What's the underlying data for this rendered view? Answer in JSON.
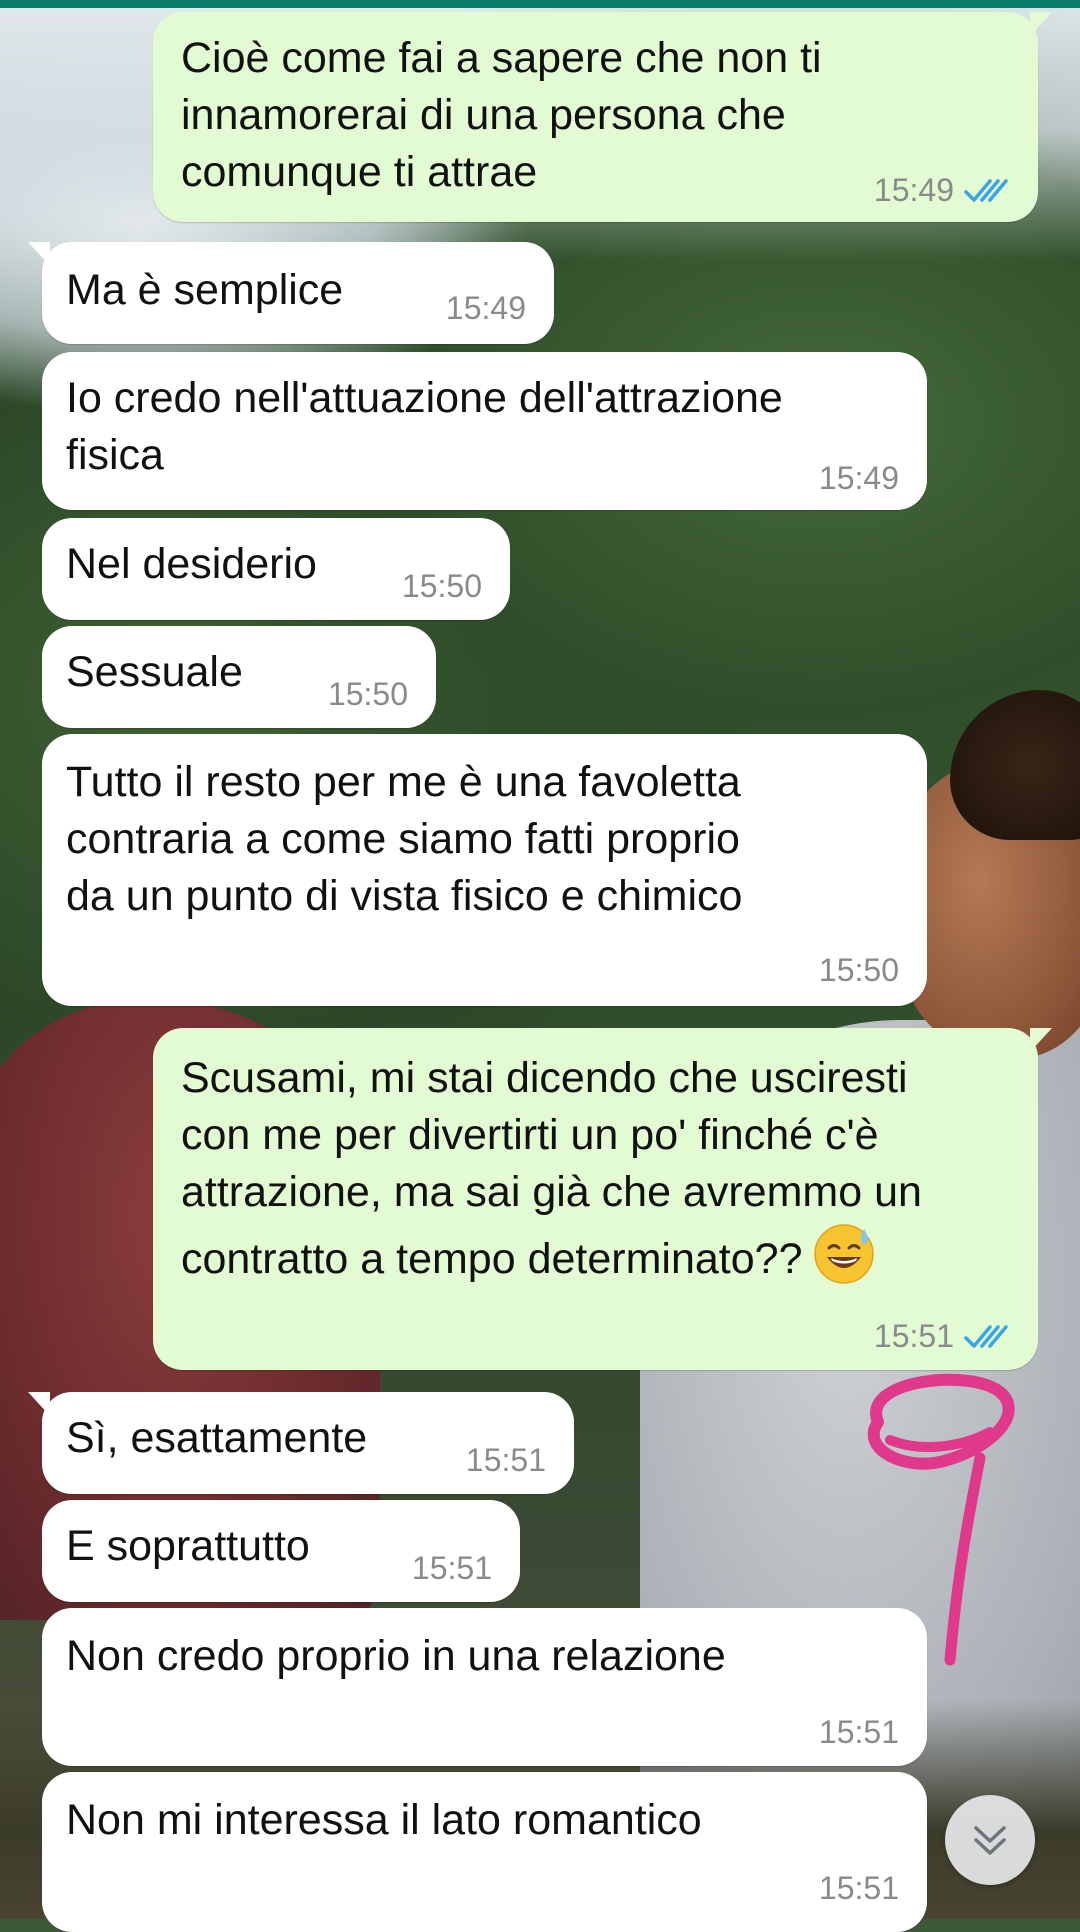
{
  "messages": [
    {
      "direction": "outgoing",
      "text": "Cioè come fai a sapere che non ti\ninnamorerai di una persona che\ncomunque ti attrae",
      "time": "15:49",
      "status_icon": "double-check-icon"
    },
    {
      "direction": "incoming",
      "text": "Ma è semplice",
      "time": "15:49"
    },
    {
      "direction": "incoming",
      "text": "Io credo nell'attuazione dell'attrazione\nfisica",
      "time": "15:49"
    },
    {
      "direction": "incoming",
      "text": "Nel desiderio",
      "time": "15:50"
    },
    {
      "direction": "incoming",
      "text": "Sessuale",
      "time": "15:50"
    },
    {
      "direction": "incoming",
      "text": "Tutto il resto per me è una favoletta\ncontraria a come siamo fatti proprio\nda un punto di vista fisico e chimico",
      "time": "15:50"
    },
    {
      "direction": "outgoing",
      "text": "Scusami, mi stai dicendo che usciresti\ncon me per divertirti un po' finché c'è\nattrazione, ma sai già che avremmo un\ncontratto a tempo determinato??",
      "emoji": "sweat-smile-emoji-icon",
      "time": "15:51",
      "status_icon": "double-check-icon"
    },
    {
      "direction": "incoming",
      "text": "Sì, esattamente",
      "time": "15:51"
    },
    {
      "direction": "incoming",
      "text": "E soprattutto",
      "time": "15:51"
    },
    {
      "direction": "incoming",
      "text": "Non credo proprio in una relazione",
      "time": "15:51"
    },
    {
      "direction": "incoming",
      "text": "Non mi interessa il lato romantico",
      "time": "15:51"
    }
  ],
  "colors": {
    "incoming_bubble": "#ffffff",
    "outgoing_bubble": "#e3fbd3",
    "timestamp": "#8a8a8a",
    "read_ticks": "#3aa4e6",
    "top_bar": "#0a7a6a",
    "annotation_marker": "#e0388a"
  },
  "scroll_button": {
    "icon": "double-chevron-down-icon"
  }
}
